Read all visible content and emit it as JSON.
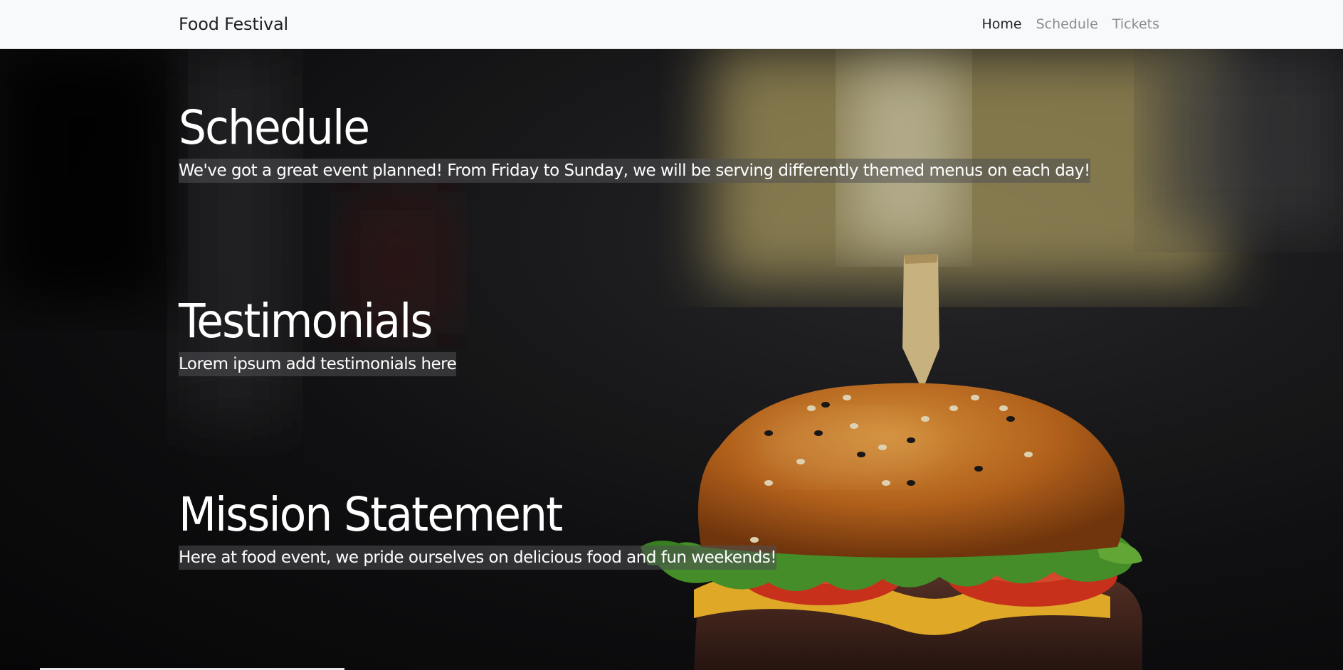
{
  "navbar": {
    "brand": "Food Festival",
    "links": [
      {
        "label": "Home",
        "active": true
      },
      {
        "label": "Schedule",
        "active": false
      },
      {
        "label": "Tickets",
        "active": false
      }
    ]
  },
  "sections": {
    "schedule": {
      "title": "Schedule",
      "text": "We've got a great event planned! From Friday to Sunday, we will be serving differently themed menus on each day!"
    },
    "testimonials": {
      "title": "Testimonials",
      "text": "Lorem ipsum add testimonials here"
    },
    "mission": {
      "title": "Mission Statement",
      "text": "Here at food event, we pride ourselves on delicious food and fun weekends!"
    }
  },
  "background": {
    "image": "burger-photo",
    "colors": {
      "bun": "#c26a1e",
      "lettuce": "#4a9a2c",
      "tomato": "#d8361f",
      "cheese": "#f2b72a",
      "patty": "#4a2a22",
      "pick": "#d8c08a",
      "bokeh_yellow": "#e8d27a"
    }
  }
}
